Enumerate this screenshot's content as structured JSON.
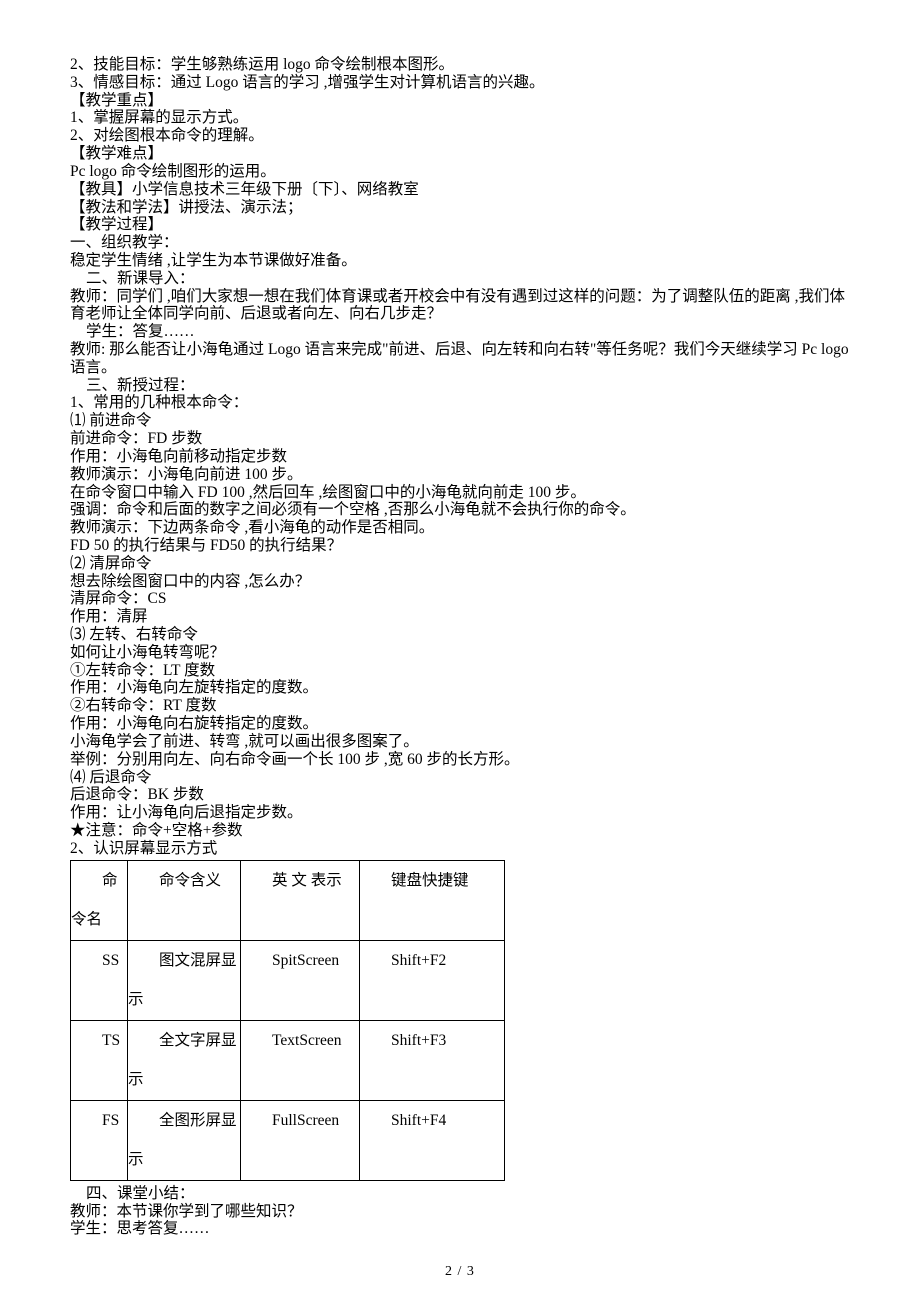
{
  "lines": {
    "l1": "2、技能目标：学生够熟练运用 logo 命令绘制根本图形。",
    "l2": "3、情感目标：通过 Logo 语言的学习 ,增强学生对计算机语言的兴趣。",
    "l3": "【教学重点】",
    "l4": "1、掌握屏幕的显示方式。",
    "l5": "2、对绘图根本命令的理解。",
    "l6": "【教学难点】",
    "l7": "Pc logo 命令绘制图形的运用。",
    "l8": "【教具】小学信息技术三年级下册〔下〕、网络教室",
    "l9": "【教法和学法】讲授法、演示法；",
    "l10": "【教学过程】",
    "l11": "一、组织教学：",
    "l12": "稳定学生情绪 ,让学生为本节课做好准备。",
    "l13": "二、新课导入：",
    "l14": "教师：同学们 ,咱们大家想一想在我们体育课或者开校会中有没有遇到过这样的问题：为了调整队伍的距离 ,我们体育老师让全体同学向前、后退或者向左、向右几步走？",
    "l15": "学生：答复……",
    "l16": "教师: 那么能否让小海龟通过 Logo 语言来完成\"前进、后退、向左转和向右转\"等任务呢？我们今天继续学习 Pc logo 语言。",
    "l17": "三、新授过程：",
    "l18": "1、常用的几种根本命令：",
    "l19": "⑴ 前进命令",
    "l20": "前进命令：FD 步数",
    "l21": "作用：小海龟向前移动指定步数",
    "l22": "教师演示：小海龟向前进 100 步。",
    "l23": "在命令窗口中输入 FD 100 ,然后回车 ,绘图窗口中的小海龟就向前走 100 步。",
    "l24": "强调：命令和后面的数字之间必须有一个空格 ,否那么小海龟就不会执行你的命令。",
    "l25": "教师演示：下边两条命令 ,看小海龟的动作是否相同。",
    "l26": "FD 50 的执行结果与 FD50 的执行结果？",
    "l27": "⑵ 清屏命令",
    "l28": "想去除绘图窗口中的内容 ,怎么办？",
    "l29": "清屏命令：CS",
    "l30": "作用：清屏",
    "l31": "⑶ 左转、右转命令",
    "l32": "如何让小海龟转弯呢？",
    "l33": "①左转命令：LT 度数",
    "l34": "作用：小海龟向左旋转指定的度数。",
    "l35": "②右转命令：RT 度数",
    "l36": "作用：小海龟向右旋转指定的度数。",
    "l37": "小海龟学会了前进、转弯 ,就可以画出很多图案了。",
    "l38": "举例：分别用向左、向右命令画一个长 100 步 ,宽 60 步的长方形。",
    "l39": "⑷ 后退命令",
    "l40": "后退命令：BK 步数",
    "l41": "作用：让小海龟向后退指定步数。",
    "l42": "★注意：命令+空格+参数",
    "l43": "2、认识屏幕显示方式",
    "l44": "四、课堂小结：",
    "l45": "教师：本节课你学到了哪些知识？",
    "l46": "学生：思考答复……"
  },
  "table": {
    "headers": {
      "c1": "命令名",
      "c2": "命令含义",
      "c3": "英 文 表示",
      "c4": "键盘快捷键"
    },
    "rows": [
      {
        "c1": "SS",
        "c2": "图文混屏显示",
        "c3": "SpitScreen",
        "c4": "Shift+F2"
      },
      {
        "c1": "TS",
        "c2": "全文字屏显示",
        "c3": "TextScreen",
        "c4": "Shift+F3"
      },
      {
        "c1": "FS",
        "c2": "全图形屏显示",
        "c3": "FullScreen",
        "c4": "Shift+F4"
      }
    ]
  },
  "footer": "2 / 3"
}
